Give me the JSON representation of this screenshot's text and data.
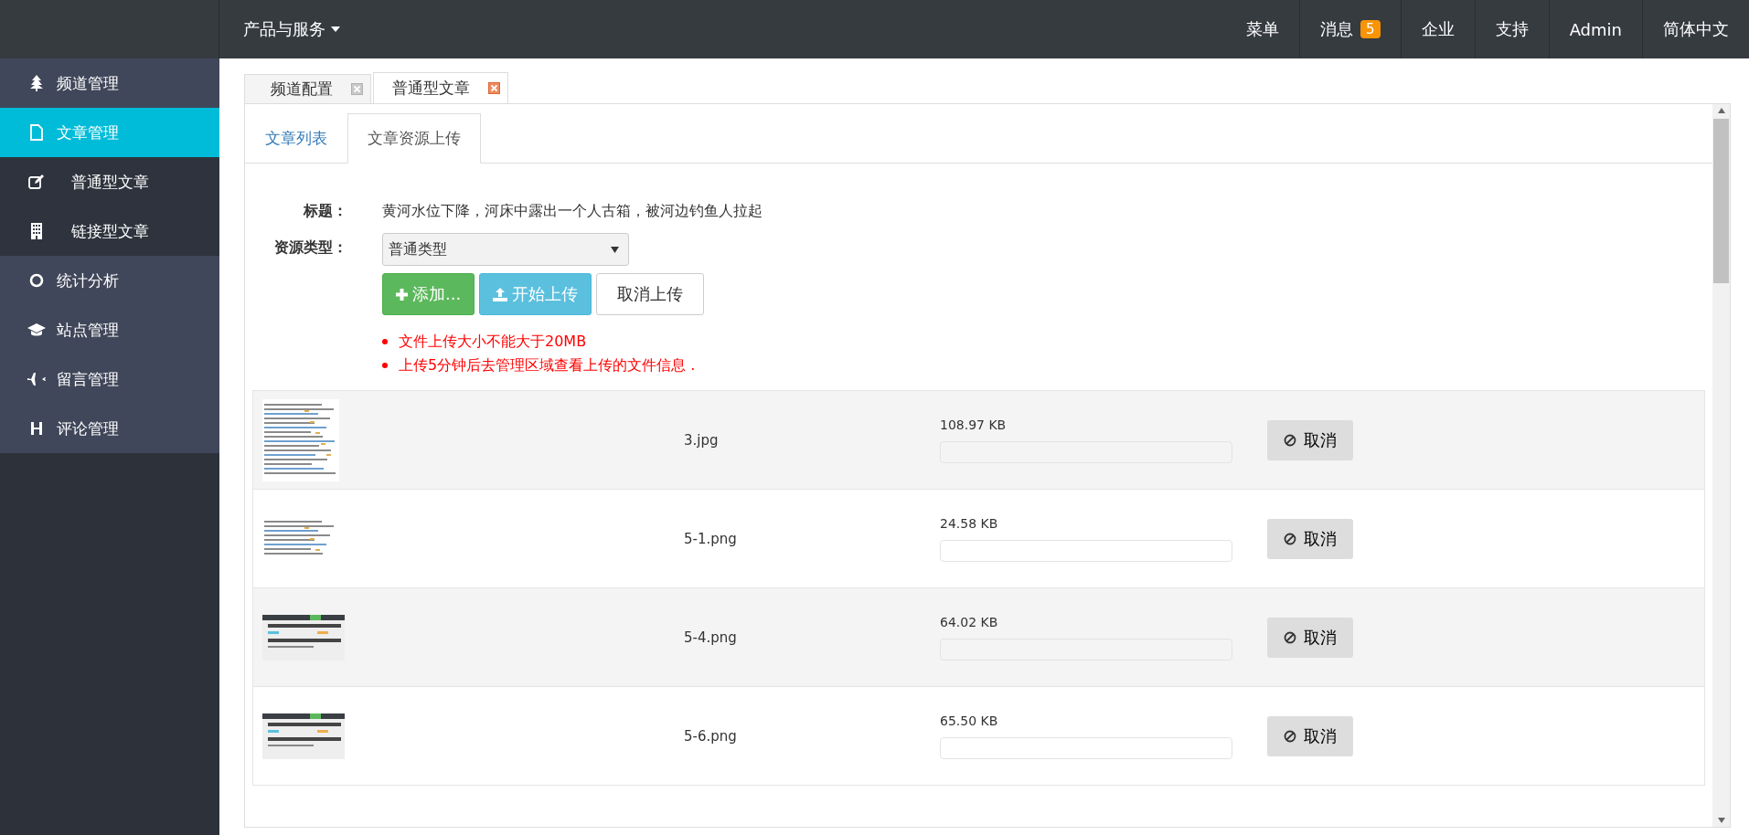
{
  "topbar": {
    "menu": "产品与服务",
    "links": [
      {
        "label": "菜单"
      },
      {
        "label": "消息",
        "badge": "5"
      },
      {
        "label": "企业"
      },
      {
        "label": "支持"
      },
      {
        "label": "Admin"
      },
      {
        "label": "简体中文"
      }
    ]
  },
  "sidebar": {
    "items": [
      {
        "label": "频道管理",
        "selected": false
      },
      {
        "label": "文章管理",
        "selected": true,
        "children": [
          {
            "label": "普通型文章",
            "selected": false
          },
          {
            "label": "链接型文章",
            "selected": false
          }
        ]
      },
      {
        "label": "统计分析",
        "selected": false
      },
      {
        "label": "站点管理",
        "selected": false
      },
      {
        "label": "留言管理",
        "selected": false
      },
      {
        "label": "评论管理",
        "selected": false
      }
    ]
  },
  "page_tabs": [
    {
      "label": "频道配置",
      "selected": false
    },
    {
      "label": "普通型文章",
      "selected": true
    }
  ],
  "tabs": [
    {
      "label": "文章列表",
      "selected": false
    },
    {
      "label": "文章资源上传",
      "selected": true
    }
  ],
  "form": {
    "title_label": "标题：",
    "title_value": "黄河水位下降，河床中露出一个人古箱，被河边钓鱼人拉起",
    "type_label": "资源类型：",
    "type_value": "普通类型"
  },
  "buttons": [
    {
      "label": "添加...",
      "kind": "add"
    },
    {
      "label": "开始上传",
      "kind": "upload"
    },
    {
      "label": "取消上传",
      "kind": "cancel"
    }
  ],
  "notes": [
    "文件上传大小不能大于20MB",
    "上传5分钟后去管理区域查看上传的文件信息 ."
  ],
  "files": [
    {
      "name": "3.jpg",
      "size": "108.97 KB",
      "level": 0,
      "action": "取消"
    },
    {
      "name": "5-1.png",
      "size": "24.58 KB",
      "level": 0,
      "action": "取消"
    },
    {
      "name": "5-4.png",
      "size": "64.02 KB",
      "level": 0,
      "action": "取消"
    },
    {
      "name": "5-6.png",
      "size": "65.50 KB",
      "level": 0,
      "action": "取消"
    }
  ]
}
